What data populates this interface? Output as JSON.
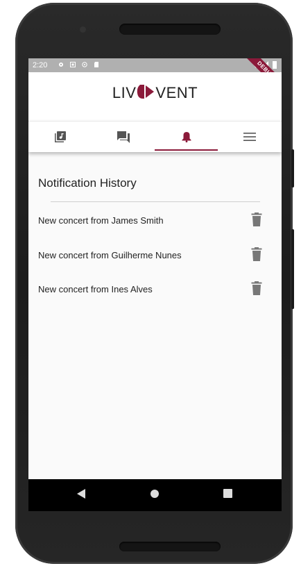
{
  "status_bar": {
    "time": "2:20",
    "debug_label": "DEBUG"
  },
  "app": {
    "logo_left": "LIV",
    "logo_right": "VENT",
    "accent_color": "#8b1a3a"
  },
  "tabs": [
    {
      "icon": "music-library-icon",
      "active": false
    },
    {
      "icon": "chat-icon",
      "active": false
    },
    {
      "icon": "bell-icon",
      "active": true
    },
    {
      "icon": "menu-icon",
      "active": false
    }
  ],
  "notifications": {
    "title": "Notification History",
    "items": [
      {
        "text": "New concert from James Smith"
      },
      {
        "text": "New concert from Guilherme Nunes"
      },
      {
        "text": "New concert from Ines Alves"
      }
    ]
  },
  "nav": {
    "back": "back-icon",
    "home": "home-icon",
    "recents": "recents-icon"
  }
}
